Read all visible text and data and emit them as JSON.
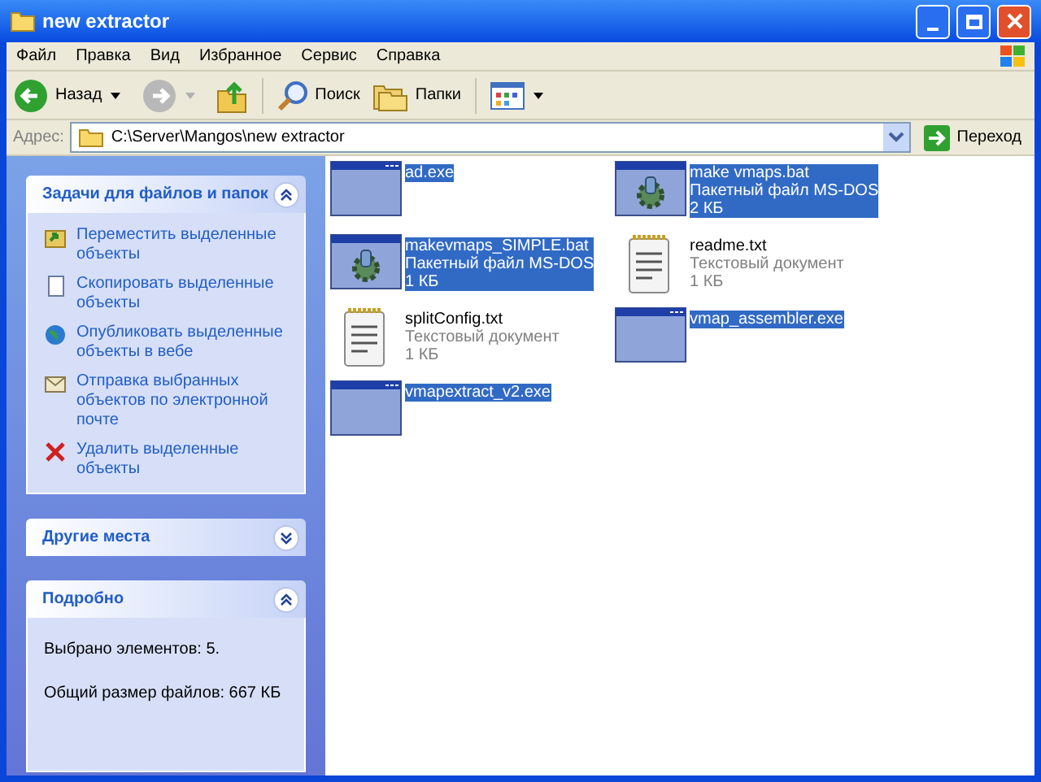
{
  "window": {
    "title": "new extractor"
  },
  "menu": [
    "Файл",
    "Правка",
    "Вид",
    "Избранное",
    "Сервис",
    "Справка"
  ],
  "toolbar": {
    "back": {
      "label": "Назад",
      "disabled": false
    },
    "forward": {
      "disabled": true
    },
    "search": "Поиск",
    "folders": "Папки"
  },
  "address": {
    "label": "Адрес:",
    "value": "C:\\Server\\Mangos\\new extractor",
    "go": "Переход"
  },
  "panels": [
    {
      "kind": "tasks",
      "title": "Задачи для файлов и папок",
      "expanded": true,
      "items": [
        {
          "label": "Переместить выделенные объекты"
        },
        {
          "label": "Скопировать выделенные объекты"
        },
        {
          "label": "Опубликовать выделенные объекты в вебе"
        },
        {
          "label": "Отправка выбранных объектов по электронной почте"
        },
        {
          "label": "Удалить выделенные объекты"
        }
      ]
    },
    {
      "kind": "places",
      "title": "Другие места",
      "expanded": false
    },
    {
      "kind": "details",
      "title": "Подробно",
      "expanded": true,
      "lines": [
        "Выбрано элементов: 5.",
        "Общий размер файлов: 667 КБ"
      ]
    }
  ],
  "files": [
    {
      "kind": "exe",
      "name": "ad.exe",
      "selected": true
    },
    {
      "kind": "bat",
      "name": "make vmaps.bat",
      "type": "Пакетный файл MS-DOS",
      "size": "2 КБ",
      "selected": true
    },
    {
      "kind": "bat",
      "name": "makevmaps_SIMPLE.bat",
      "type": "Пакетный файл MS-DOS",
      "size": "1 КБ",
      "selected": true
    },
    {
      "kind": "txt",
      "name": "readme.txt",
      "type": "Текстовый документ",
      "size": "1 КБ",
      "selected": false
    },
    {
      "kind": "txt",
      "name": "splitConfig.txt",
      "type": "Текстовый документ",
      "size": "1 КБ",
      "selected": false
    },
    {
      "kind": "exe",
      "name": "vmap_assembler.exe",
      "selected": true
    },
    {
      "kind": "exe",
      "name": "vmapextract_v2.exe",
      "selected": true
    }
  ]
}
